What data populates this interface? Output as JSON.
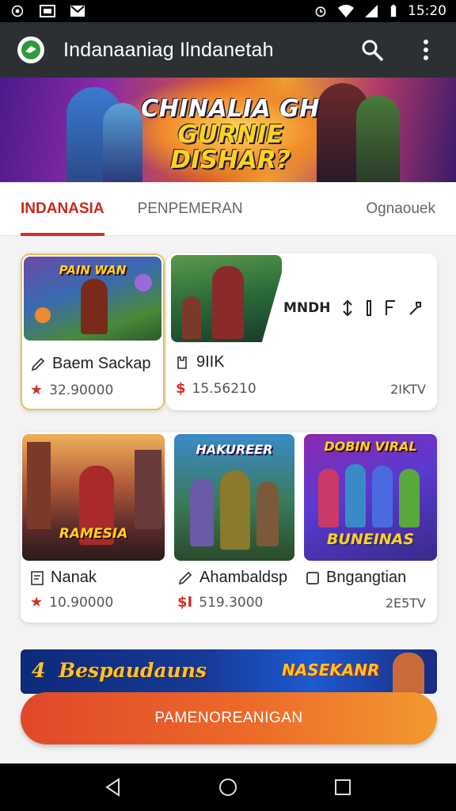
{
  "status_bar": {
    "time": "15:20"
  },
  "app_bar": {
    "title": "Indanaaniag Ilndanetah"
  },
  "hero": {
    "line1": "CHINALIA GH",
    "line2": "GURNIE DISHAR?"
  },
  "tabs": [
    {
      "label": "INDANASIA",
      "active": true
    },
    {
      "label": "PENPEMERAN",
      "active": false
    },
    {
      "label": "Ognaouek",
      "active": false
    }
  ],
  "row1": {
    "card1": {
      "title": "Baem Sackap",
      "meta": "32.90000"
    },
    "card2": {
      "title": "9IIK",
      "meta": "15.56210",
      "right": "2IKTV",
      "action_label": "MNDH"
    }
  },
  "row2": {
    "card1": {
      "title": "Nanak",
      "meta": "10.90000"
    },
    "card2": {
      "title": "Ahambaldsp",
      "meta": "519.3000"
    },
    "card3": {
      "title": "Bngangtian",
      "right": "2E5TV",
      "thumb_label_top": "DOBIN VIRAL",
      "thumb_label_bottom": "BUNEINAS"
    }
  },
  "thumbs": {
    "row1_card1": "PAIN WAN",
    "row2_card1": "RAMESIA",
    "row2_card2": "HAKUREER"
  },
  "promo": {
    "text": "Bespaudauns",
    "badge": "NASEKANR",
    "number": "4"
  },
  "cta": {
    "label": "PAMENOREANIGAN"
  },
  "colors": {
    "accent": "#d2302a",
    "app_bar": "#2d3032",
    "cta_start": "#e0482a",
    "cta_end": "#f39a30"
  }
}
